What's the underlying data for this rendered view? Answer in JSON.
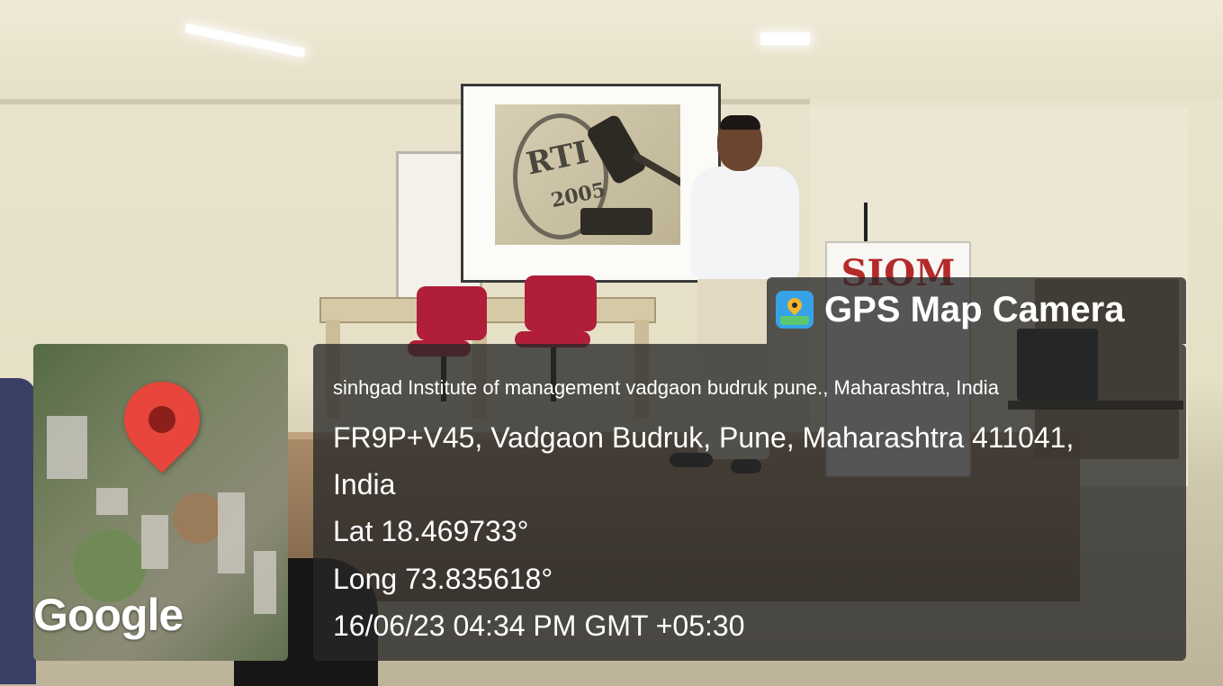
{
  "overlay": {
    "brand": "GPS Map Camera",
    "place_name": "sinhgad Institute of management vadgaon budruk pune., Maharashtra, India",
    "address_line1": "FR9P+V45, Vadgaon Budruk, Pune, Maharashtra 411041,",
    "address_line2": "India",
    "latitude": "Lat 18.469733°",
    "longitude": "Long 73.835618°",
    "datetime": "16/06/23 04:34 PM GMT +05:30",
    "map_provider": "Google"
  },
  "scene": {
    "slide_text": "RTI",
    "slide_year": "2005",
    "podium_text": "SIOM",
    "colors": {
      "pin": "#e8453c",
      "overlay_bg": "rgba(40,40,40,0.78)",
      "podium_text": "#b42a2a"
    }
  }
}
